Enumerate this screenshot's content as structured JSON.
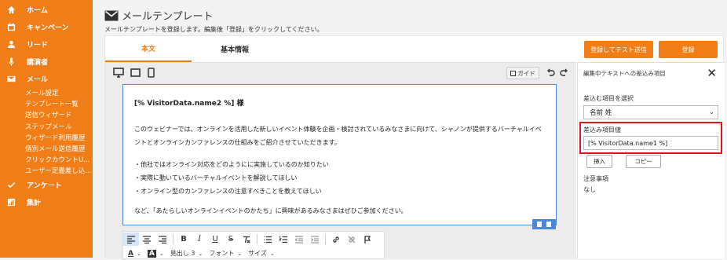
{
  "sidebar": {
    "items": [
      {
        "label": "ホーム",
        "icon": "home-icon"
      },
      {
        "label": "キャンペーン",
        "icon": "calendar-icon"
      },
      {
        "label": "リード",
        "icon": "person-icon"
      },
      {
        "label": "講演者",
        "icon": "mic-icon"
      },
      {
        "label": "メール",
        "icon": "mail-icon"
      }
    ],
    "mail_sub": [
      "メール設定",
      "テンプレート一覧",
      "送信ウィザード",
      "ステップメール",
      "ウィザード利用履歴",
      "個別メール送信履歴",
      "クリックカウントU...",
      "ユーザー定義差し込..."
    ],
    "bottom_items": [
      {
        "label": "アンケート",
        "icon": "check-icon"
      },
      {
        "label": "集計",
        "icon": "chart-icon"
      }
    ]
  },
  "page": {
    "title": "メールテンプレート",
    "subtitle": "メールテンプレートを登録します。編集後「登録」をクリックしてください。"
  },
  "tabs": [
    "本文",
    "基本情報"
  ],
  "buttons": {
    "test_send": "登録してテスト送信",
    "register": "登録"
  },
  "toolbar": {
    "guide": "ガイド"
  },
  "document": {
    "salutation": "[% VisitorData.name2 %] 様",
    "para1_line1": "このウェビナーでは、オンラインを活用した新しいイベント体験を企画・検討されているみなさまに向けて、シャノンが提供するバーチャルイベ",
    "para1_line2": "ントとオンラインカンファレンスの仕組みをご紹介させていただきます。",
    "bullets": [
      "・他社ではオンライン対応をどのようにに実施しているのか知りたい",
      "・実際に動いているバーチャルイベントを解説してほしい",
      "・オンライン型のカンファレンスの注意すべきことを教えてほしい"
    ],
    "closing": "など、「あたらしいオンラインイベントのかたち」に興味があるみなさまはぜひご参加ください。"
  },
  "format_bar": {
    "heading": "見出し 3",
    "font": "フォント",
    "size": "サイズ",
    "text_color_glyph": "A",
    "bg_color_glyph": "A"
  },
  "panel": {
    "title": "編集中テキストへの差込み項目",
    "select_label": "差込む項目を選択",
    "select_value": "名前 姓",
    "value_label": "差込み項目値",
    "value": "[% VisitorData.name1 %]",
    "insert": "挿入",
    "copy": "コピー",
    "notes_label": "注意事項",
    "notes_value": "なし"
  },
  "colors": {
    "accent": "#f07d16",
    "highlight": "#e0151b",
    "editor_border": "#4a89d8"
  }
}
